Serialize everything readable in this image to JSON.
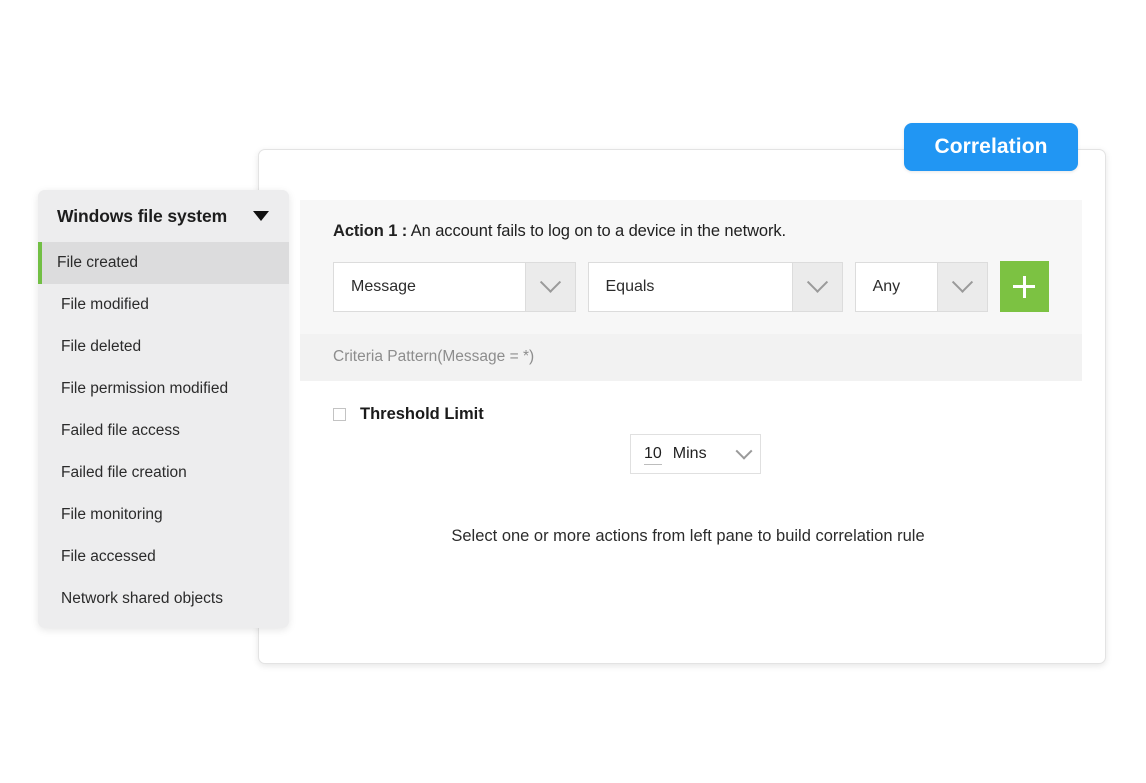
{
  "tab": {
    "label": "Correlation"
  },
  "sidebar": {
    "title": "Windows file system",
    "caret_icon": "caret-down-icon",
    "items": [
      {
        "label": "File created",
        "active": true
      },
      {
        "label": "File modified",
        "active": false
      },
      {
        "label": "File deleted",
        "active": false
      },
      {
        "label": "File permission modified",
        "active": false
      },
      {
        "label": "Failed file access",
        "active": false
      },
      {
        "label": "Failed file creation",
        "active": false
      },
      {
        "label": "File monitoring",
        "active": false
      },
      {
        "label": "File accessed",
        "active": false
      },
      {
        "label": "Network shared objects",
        "active": false
      }
    ]
  },
  "action": {
    "title_prefix": "Action 1 :",
    "title_text": "An account fails to log on to a device in the network.",
    "title_full": "Action 1 : An account fails to log on to a device in the network.",
    "field_select": {
      "value": "Message",
      "chevron_icon": "chevron-down-icon"
    },
    "operator_select": {
      "value": "Equals",
      "chevron_icon": "chevron-down-icon"
    },
    "value_select": {
      "value": "Any",
      "chevron_icon": "chevron-down-icon"
    },
    "add_button": {
      "icon": "plus-icon",
      "color": "#7cc242"
    },
    "criteria_pattern": "Criteria Pattern(Message = *)"
  },
  "threshold": {
    "checkbox_checked": false,
    "label": "Threshold Limit",
    "duration_value": "10",
    "duration_unit": "Mins",
    "chevron_icon": "chevron-down-icon"
  },
  "hint": {
    "text": "Select one or more actions from left pane to build correlation rule"
  },
  "colors": {
    "accent_blue": "#2196f3",
    "accent_green": "#7cc242",
    "active_bar_green": "#72bf44",
    "panel_gray": "#f7f7f7",
    "criteria_gray": "#f2f2f2",
    "sidebar_gray": "#ededee",
    "sidebar_active_gray": "#dcdcdd"
  }
}
